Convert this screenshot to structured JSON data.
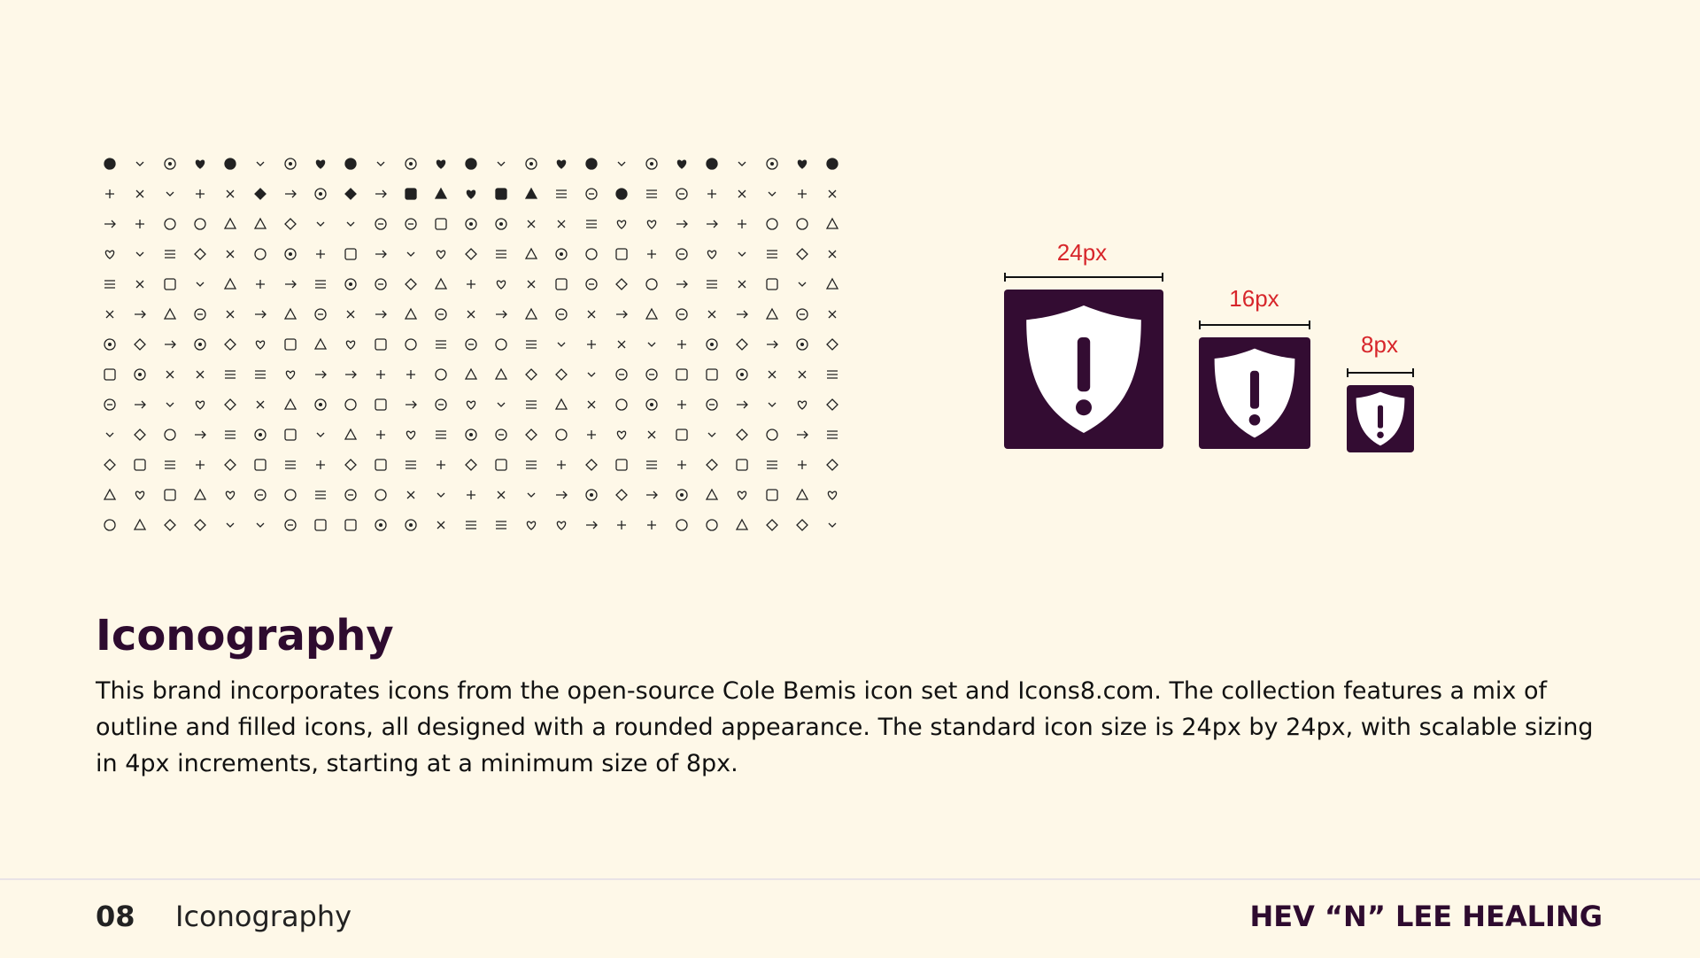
{
  "slide": {
    "title": "Iconography",
    "description": "This brand incorporates icons from the open-source Cole Bemis icon set and Icons8.com. The collection features a mix of outline and filled icons, all designed with a rounded appearance. The standard icon size is 24px by 24px, with scalable sizing in 4px increments, starting at a minimum size of 8px."
  },
  "icon_sizes": [
    {
      "label": "24px",
      "icon": "shield-alert-icon"
    },
    {
      "label": "16px",
      "icon": "shield-alert-icon"
    },
    {
      "label": "8px",
      "icon": "shield-alert-icon"
    }
  ],
  "icon_grid": {
    "rows": 13,
    "columns": 25,
    "filled_rows": 2,
    "icons": [
      "arrow-up-icon",
      "clock-icon",
      "eye-icon",
      "headphones-icon",
      "sliders-icon",
      "walk-icon",
      "run-icon",
      "lock-icon",
      "alert-circle-icon",
      "message-square-icon",
      "mail-icon",
      "refresh-icon",
      "lock-icon",
      "message-icon",
      "briefcase-icon",
      "map-icon",
      "alert-triangle-icon",
      "compass-icon",
      "archive-icon",
      "chevron-down-icon",
      "help-circle-icon",
      "message-circle-icon",
      "facebook-icon",
      "user-icon",
      "send-icon"
    ]
  },
  "footer": {
    "page_number": "08",
    "section": "Iconography",
    "brand": "HEV “N” LEE HEALING"
  },
  "colors": {
    "background": "#fef8e8",
    "primary": "#330c32",
    "accent_red": "#d7262b",
    "text": "#111111"
  }
}
